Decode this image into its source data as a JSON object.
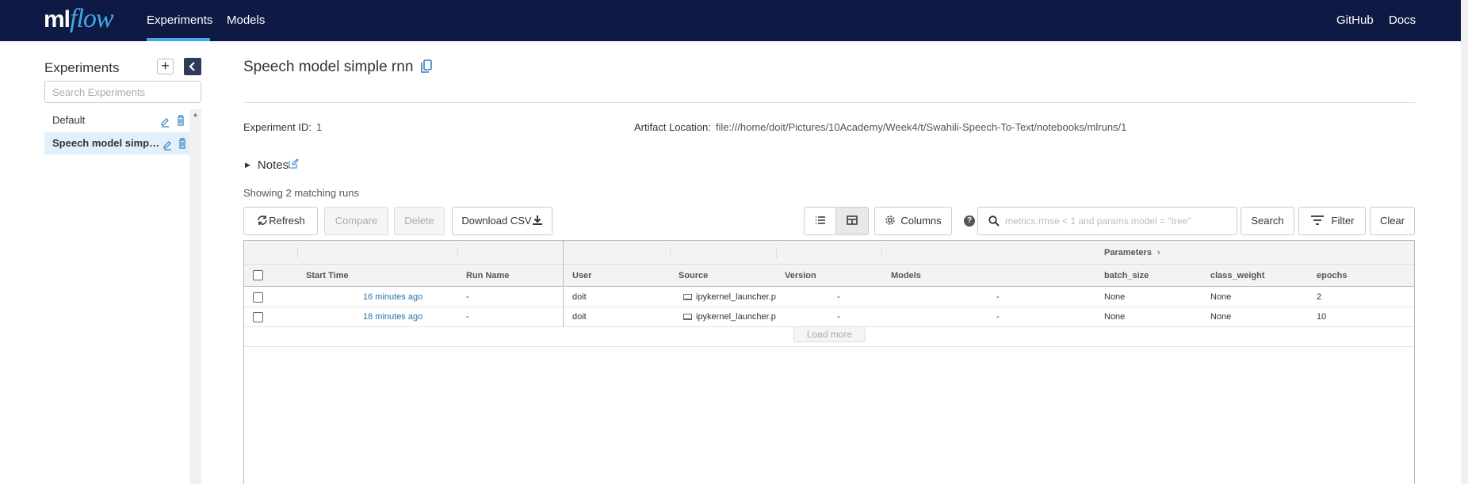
{
  "nav": {
    "logo_ml": "ml",
    "logo_flow": "flow",
    "tabs": [
      {
        "label": "Experiments",
        "active": true
      },
      {
        "label": "Models",
        "active": false
      }
    ],
    "right_links": [
      "GitHub",
      "Docs"
    ]
  },
  "sidebar": {
    "title": "Experiments",
    "add_label": "+",
    "collapse_icon": "chevron-left-icon",
    "search_placeholder": "Search Experiments",
    "items": [
      {
        "name": "Default",
        "active": false
      },
      {
        "name": "Speech model simple rnn",
        "active": true
      }
    ]
  },
  "experiment": {
    "title": "Speech model simple rnn",
    "id_label": "Experiment ID:",
    "id_value": "1",
    "artifact_label": "Artifact Location:",
    "artifact_value": "file:///home/doit/Pictures/10Academy/Week4/t/Swahili-Speech-To-Text/notebooks/mlruns/1",
    "notes_label": "Notes"
  },
  "runs": {
    "showing_text": "Showing 2 matching runs",
    "buttons": {
      "refresh": "Refresh",
      "compare": "Compare",
      "delete": "Delete",
      "download": "Download CSV",
      "columns": "Columns",
      "search": "Search",
      "filter": "Filter",
      "clear": "Clear"
    },
    "search_placeholder": "metrics.rmse < 1 and params.model = \"tree\"",
    "group_header": "Parameters",
    "columns": [
      "Start Time",
      "Run Name",
      "User",
      "Source",
      "Version",
      "Models",
      "batch_size",
      "class_weight",
      "epochs"
    ],
    "rows": [
      {
        "start_time": "16 minutes ago",
        "run_name": "-",
        "user": "doit",
        "source": "ipykernel_launcher.p",
        "version": "-",
        "models": "-",
        "batch_size": "None",
        "class_weight": "None",
        "epochs": "2"
      },
      {
        "start_time": "18 minutes ago",
        "run_name": "-",
        "user": "doit",
        "source": "ipykernel_launcher.p",
        "version": "-",
        "models": "-",
        "batch_size": "None",
        "class_weight": "None",
        "epochs": "10"
      }
    ],
    "load_more": "Load more"
  },
  "colors": {
    "nav_bg": "#0e1a44",
    "accent": "#43a7e8",
    "link": "#2874a6",
    "selected_bg": "#e2f0fb"
  }
}
